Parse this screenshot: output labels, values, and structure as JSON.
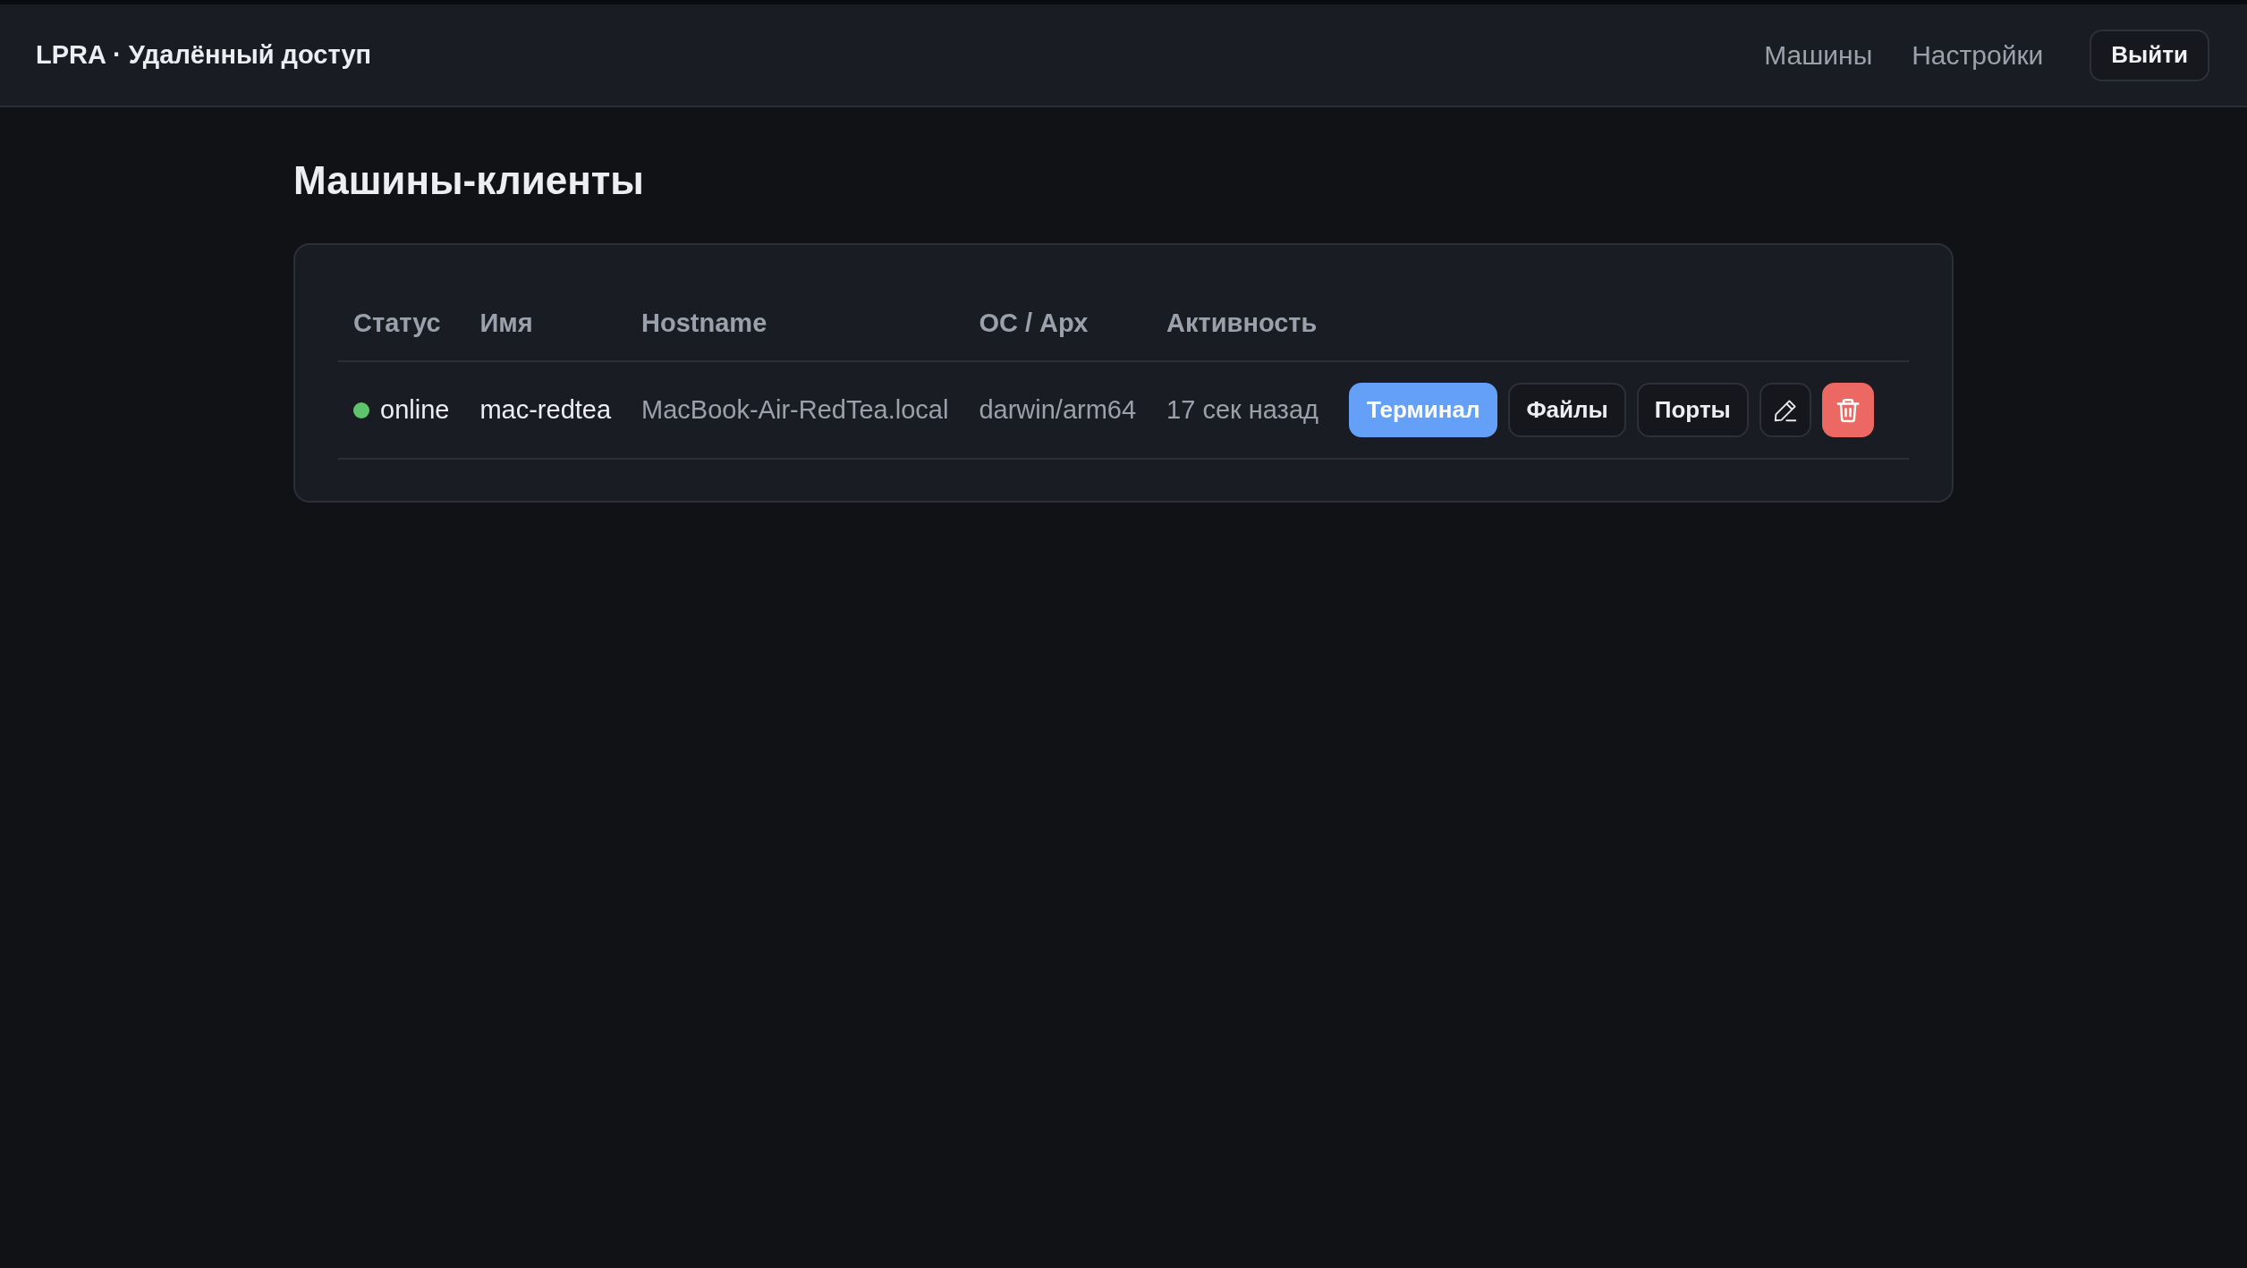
{
  "header": {
    "brand": "LPRA · Удалённый доступ",
    "nav": [
      {
        "label": "Машины"
      },
      {
        "label": "Настройки"
      }
    ],
    "logout": "Выйти"
  },
  "page_title": "Машины-клиенты",
  "table": {
    "columns": [
      "Статус",
      "Имя",
      "Hostname",
      "ОС / Арх",
      "Активность"
    ],
    "rows": [
      {
        "status": {
          "label": "online",
          "color": "#5ec46c"
        },
        "name": "mac-redtea",
        "hostname": "MacBook-Air-RedTea.local",
        "os_arch": "darwin/arm64",
        "activity": "17 сек назад",
        "actions": [
          {
            "kind": "primary",
            "label": "Терминал"
          },
          {
            "kind": "outline",
            "label": "Файлы"
          },
          {
            "kind": "outline",
            "label": "Порты"
          },
          {
            "kind": "edit"
          },
          {
            "kind": "delete"
          }
        ]
      }
    ]
  }
}
